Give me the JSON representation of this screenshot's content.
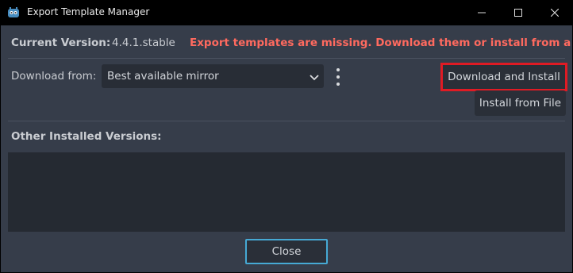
{
  "window": {
    "title": "Export Template Manager",
    "controls": {
      "minimize": "minimize-icon",
      "maximize": "maximize-icon",
      "close": "close-icon"
    }
  },
  "current_version": {
    "label": "Current Version:",
    "value": "4.4.1.stable",
    "warning": "Export templates are missing. Download them or install from a file."
  },
  "download": {
    "label": "Download from:",
    "mirror_selected": "Best available mirror",
    "download_install_label": "Download and Install",
    "install_file_label": "Install from File"
  },
  "other_versions": {
    "label": "Other Installed Versions:",
    "items": []
  },
  "footer": {
    "close_label": "Close"
  },
  "colors": {
    "background": "#363d4a",
    "warning": "#ff6a5f",
    "highlight_box": "#e01b24",
    "focus_border": "#46a9d4"
  }
}
